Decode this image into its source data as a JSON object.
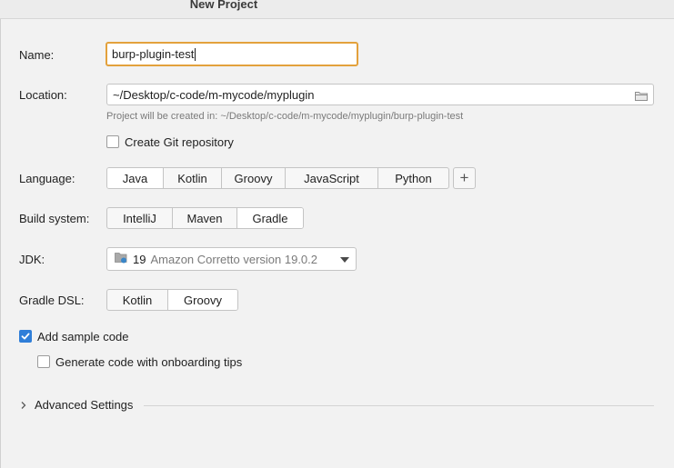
{
  "window": {
    "title": "New Project"
  },
  "form": {
    "name_label": "Name:",
    "name_value": "burp-plugin-test",
    "location_label": "Location:",
    "location_value": "~/Desktop/c-code/m-mycode/myplugin",
    "location_hint": "Project will be created in: ~/Desktop/c-code/m-mycode/myplugin/burp-plugin-test",
    "git_label": "Create Git repository",
    "git_checked": false,
    "language_label": "Language:",
    "languages": [
      "Java",
      "Kotlin",
      "Groovy",
      "JavaScript",
      "Python"
    ],
    "language_selected": "Java",
    "add_language_label": "+",
    "build_label": "Build system:",
    "build_systems": [
      "IntelliJ",
      "Maven",
      "Gradle"
    ],
    "build_selected": "Gradle",
    "jdk_label": "JDK:",
    "jdk_version": "19",
    "jdk_name": "Amazon Corretto version 19.0.2",
    "dsl_label": "Gradle DSL:",
    "dsl_options": [
      "Kotlin",
      "Groovy"
    ],
    "dsl_selected": "Groovy",
    "sample_code_label": "Add sample code",
    "sample_code_checked": true,
    "onboarding_label": "Generate code with onboarding tips",
    "onboarding_checked": false,
    "advanced_label": "Advanced Settings"
  },
  "colors": {
    "focus_border": "#e3a13c",
    "checkbox_checked": "#2f7ed8",
    "background": "#f2f2f2"
  }
}
